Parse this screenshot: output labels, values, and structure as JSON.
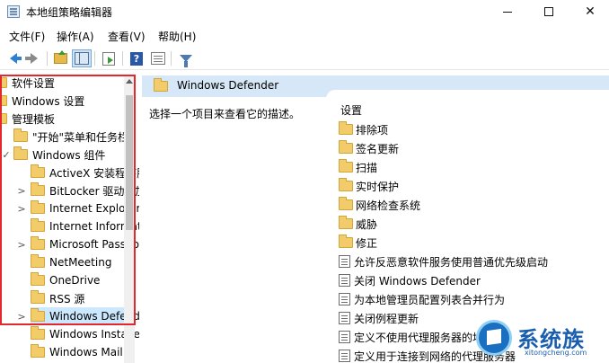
{
  "window": {
    "title": "本地组策略编辑器",
    "minimize_glyph": "—",
    "maximize_glyph": "☐",
    "close_glyph": "✕"
  },
  "menu": [
    "文件(F)",
    "操作(A)",
    "查看(V)",
    "帮助(H)"
  ],
  "toolbar": {
    "icons": [
      "back-arrow-icon",
      "forward-arrow-icon",
      "folder-up-icon",
      "show-hide-tree-icon",
      "export-list-icon",
      "help-icon",
      "properties-icon",
      "filter-icon"
    ],
    "help_glyph": "?"
  },
  "tree": {
    "items": [
      {
        "label": "软件设置",
        "expander": ""
      },
      {
        "label": "Windows 设置",
        "expander": ""
      },
      {
        "label": "管理模板",
        "expander": ""
      },
      {
        "label": "\"开始\"菜单和任务栏",
        "expander": ""
      },
      {
        "label": "Windows 组件",
        "expander": "✓"
      },
      {
        "label": "ActiveX 安装程序服务",
        "expander": ""
      },
      {
        "label": "BitLocker 驱动器加密",
        "expander": ">"
      },
      {
        "label": "Internet Explorer",
        "expander": ">"
      },
      {
        "label": "Internet Information Services",
        "expander": ""
      },
      {
        "label": "Microsoft Passport for Work",
        "expander": ">"
      },
      {
        "label": "NetMeeting",
        "expander": ""
      },
      {
        "label": "OneDrive",
        "expander": ""
      },
      {
        "label": "RSS 源",
        "expander": ""
      },
      {
        "label": "Windows Defender",
        "expander": ">",
        "selected": true
      },
      {
        "label": "Windows Installer",
        "expander": ""
      },
      {
        "label": "Windows Mail",
        "expander": ""
      }
    ]
  },
  "details": {
    "header_title": "Windows Defender",
    "description": "选择一个项目来查看它的描述。",
    "column_header": "设置",
    "folders": [
      "排除项",
      "签名更新",
      "扫描",
      "实时保护",
      "网络检查系统",
      "威胁",
      "修正"
    ],
    "settings": [
      "允许反恶意软件服务使用普通优先级启动",
      "关闭 Windows Defender",
      "为本地管理员配置列表合并行为",
      "关闭例程更新",
      "定义不使用代理服务器的地址",
      "定义用于连接到网络的代理服务器"
    ]
  },
  "watermark": {
    "text": "系统族",
    "url": "xitongcheng.com"
  }
}
